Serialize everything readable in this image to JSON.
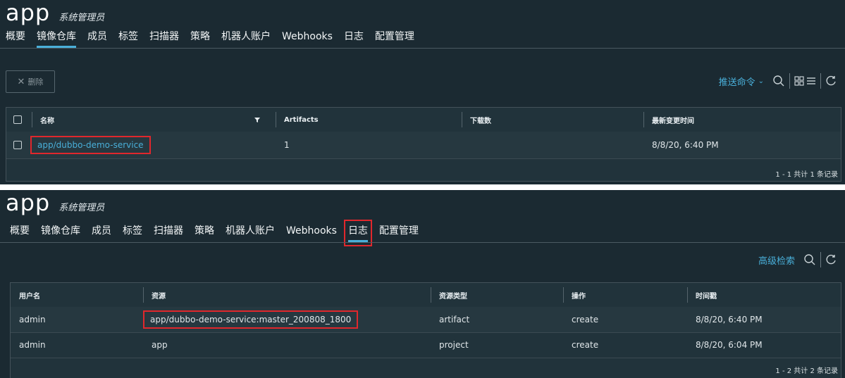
{
  "top": {
    "app_name": "app",
    "role": "系统管理员",
    "tabs": [
      "概要",
      "镜像仓库",
      "成员",
      "标签",
      "扫描器",
      "策略",
      "机器人账户",
      "Webhooks",
      "日志",
      "配置管理"
    ],
    "active_tab": "镜像仓库",
    "delete_label": "删除",
    "push_command": "推送命令",
    "table": {
      "columns": [
        "名称",
        "Artifacts",
        "下载数",
        "最新变更时间"
      ],
      "rows": [
        {
          "name": "app/dubbo-demo-service",
          "artifacts": "1",
          "pulls": "",
          "updated": "8/8/20, 6:40 PM"
        }
      ],
      "footer": "1 - 1 共计 1 条记录"
    }
  },
  "bottom": {
    "app_name": "app",
    "role": "系统管理员",
    "tabs": [
      "概要",
      "镜像仓库",
      "成员",
      "标签",
      "扫描器",
      "策略",
      "机器人账户",
      "Webhooks",
      "日志",
      "配置管理"
    ],
    "active_tab": "日志",
    "advanced_search": "高级检索",
    "table": {
      "columns": [
        "用户名",
        "资源",
        "资源类型",
        "操作",
        "时间戳"
      ],
      "rows": [
        {
          "user": "admin",
          "resource": "app/dubbo-demo-service:master_200808_1800",
          "type": "artifact",
          "op": "create",
          "time": "8/8/20, 6:40 PM"
        },
        {
          "user": "admin",
          "resource": "app",
          "type": "project",
          "op": "create",
          "time": "8/8/20, 6:04 PM"
        }
      ],
      "footer": "1 - 2 共计 2 条记录"
    }
  },
  "colors": {
    "accent": "#49afd9",
    "highlight": "#e0272c",
    "panel": "#1b2a32"
  },
  "icons": [
    "close-icon",
    "chevron-down-icon",
    "search-icon",
    "grid-view-icon",
    "list-view-icon",
    "refresh-icon",
    "filter-icon"
  ]
}
